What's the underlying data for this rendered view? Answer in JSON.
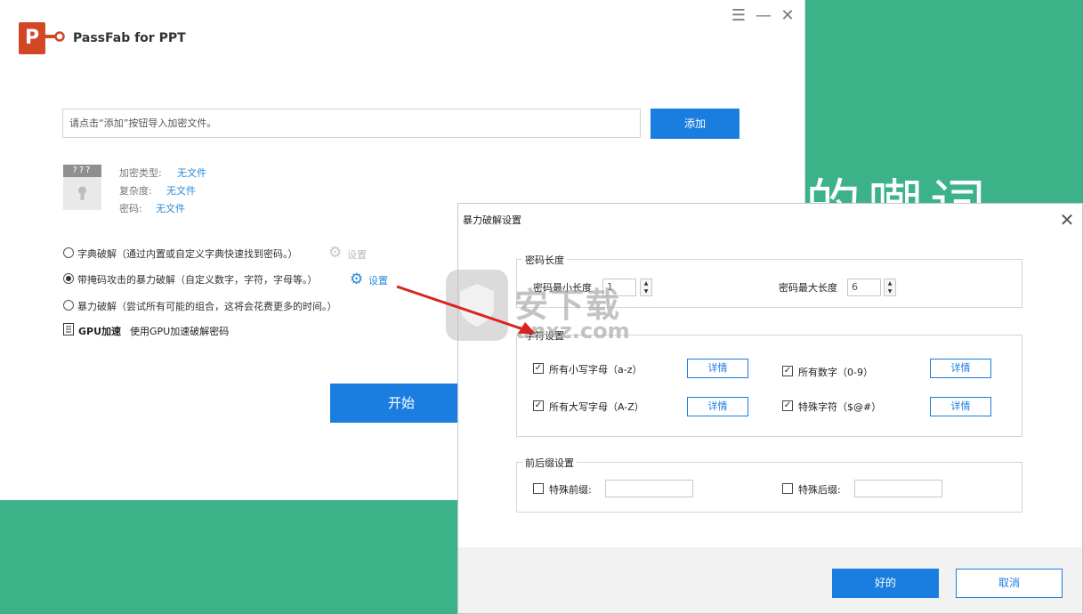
{
  "background": {
    "deco_text": "的嘲词"
  },
  "app": {
    "title": "PassFab for PPT",
    "logo_letter": "P"
  },
  "window_controls": {
    "menu": "☰",
    "minimize": "—",
    "close": "✕"
  },
  "file": {
    "placeholder": "请点击“添加”按钮导入加密文件。",
    "add_label": "添加",
    "thumb_label": "???",
    "encrypt_type_label": "加密类型:",
    "encrypt_type_value": "无文件",
    "complexity_label": "复杂度:",
    "complexity_value": "无文件",
    "password_label": "密码:",
    "password_value": "无文件"
  },
  "attack_options": [
    {
      "label": "字典破解（通过内置或自定义字典快速找到密码。）",
      "settings": "设置",
      "selected": false
    },
    {
      "label": "带掩码攻击的暴力破解（自定义数字，字符，字母等。）",
      "settings": "设置",
      "selected": true
    },
    {
      "label": "暴力破解（尝试所有可能的组合，这将会花费更多的时间。）",
      "selected": false
    }
  ],
  "gpu": {
    "label": "GPU加速",
    "desc": "使用GPU加速破解密码"
  },
  "start_label": "开始",
  "dialog": {
    "title": "暴力破解设置",
    "close": "✕",
    "pwd_length": {
      "legend": "密码长度",
      "min_label": "密码最小长度",
      "min_value": "1",
      "max_label": "密码最大长度",
      "max_value": "6"
    },
    "charset": {
      "legend": "字符设置",
      "items": [
        {
          "label": "所有小写字母（a-z）",
          "checked": true,
          "detail": "详情"
        },
        {
          "label": "所有数字（0-9）",
          "checked": true,
          "detail": "详情"
        },
        {
          "label": "所有大写字母（A-Z）",
          "checked": true,
          "detail": "详情"
        },
        {
          "label": "特殊字符（$@#）",
          "checked": true,
          "detail": "详情"
        }
      ]
    },
    "affix": {
      "legend": "前后缀设置",
      "prefix_label": "特殊前缀:",
      "suffix_label": "特殊后缀:"
    },
    "ok_label": "好的",
    "cancel_label": "取消"
  },
  "watermark": {
    "text": "安下载",
    "url": "anxz.com"
  }
}
